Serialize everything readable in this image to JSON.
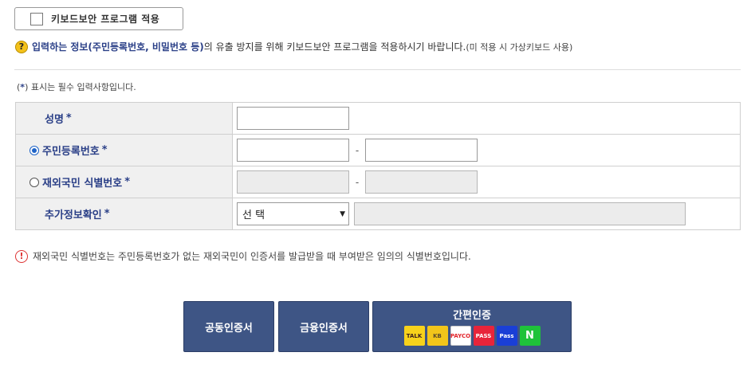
{
  "keyboard_security": {
    "label": "키보드보안 프로그램 적용"
  },
  "notice": {
    "icon": "?",
    "emphasis": "입력하는 정보(주민등록번호, 비밀번호 등)",
    "text": "의 유출 방지를 위해 키보드보안 프로그램을 적용하시기 바랍니다.",
    "small": "(미 적용 시 가상키보드 사용)"
  },
  "required_note": {
    "open": "(",
    "star": "*",
    "text": ") 표시는 필수 입력사항입니다."
  },
  "form": {
    "required_mark": "*",
    "name_label": "성명",
    "resident_label": "주민등록번호",
    "foreigner_label": "재외국민 식별번호",
    "extra_label": "추가정보확인",
    "dash": "-",
    "select_value": "선 택",
    "select_caret": "▼"
  },
  "warning": {
    "icon": "!",
    "text": "재외국민 식별번호는 주민등록번호가 없는 재외국민이 인증서를 발급받을 때 부여받은 임의의 식별번호입니다."
  },
  "buttons": {
    "joint_cert": "공동인증서",
    "financial_cert": "금융인증서",
    "simple_auth": "간편인증"
  },
  "simple_logos": [
    {
      "icon": "kakao-talk-icon",
      "text": "TALK",
      "bg": "#f7d21b",
      "fg": "#3b1e1e"
    },
    {
      "icon": "kb-icon",
      "text": "KB",
      "bg": "#f2c51a",
      "fg": "#5a4a2a"
    },
    {
      "icon": "payco-icon",
      "text": "PAYCO",
      "bg": "#ffffff",
      "fg": "#e2242b"
    },
    {
      "icon": "pass-red-icon",
      "text": "PASS",
      "bg": "#e8243a",
      "fg": "#ffffff"
    },
    {
      "icon": "samsung-pass-icon",
      "text": "Pass",
      "bg": "#1a3fd6",
      "fg": "#ffffff"
    },
    {
      "icon": "naver-icon",
      "text": "N",
      "bg": "#1fc23a",
      "fg": "#ffffff"
    }
  ],
  "colors": {
    "accent": "#2a3f87",
    "button_bg": "#3e5585",
    "radio_on": "#1e63c7",
    "warn": "#dd3333",
    "question": "#f3c11b"
  }
}
